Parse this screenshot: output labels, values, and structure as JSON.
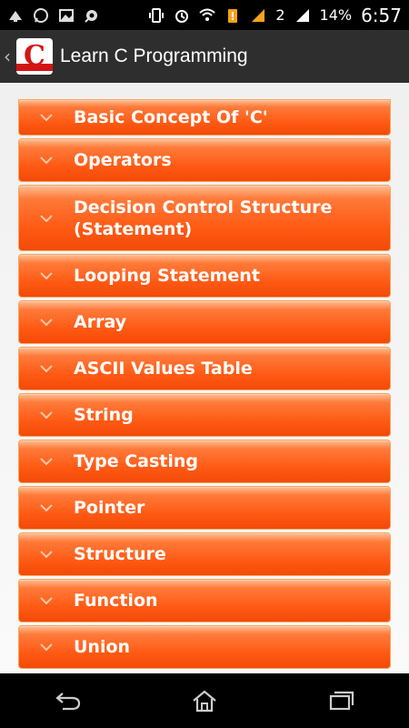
{
  "status_bar": {
    "battery_percent": "14%",
    "time": "6:57",
    "sim_number": "2",
    "left_icons": [
      "cast-icon",
      "whatsapp-icon",
      "gallery-icon",
      "camera-icon"
    ],
    "right_icons": [
      "vibrate-icon",
      "alarm-icon",
      "wifi-icon",
      "battery-warning-icon",
      "signal-icon",
      "signal-icon"
    ]
  },
  "action_bar": {
    "title": "Learn C Programming",
    "logo_letter": "C",
    "logo_caption": "Programming"
  },
  "menu": {
    "items": [
      {
        "label": "Basic Concept Of 'C'"
      },
      {
        "label": "Operators"
      },
      {
        "label": "Decision Control Structure (Statement)"
      },
      {
        "label": "Looping Statement"
      },
      {
        "label": "Array"
      },
      {
        "label": "ASCII Values Table"
      },
      {
        "label": "String"
      },
      {
        "label": "Type Casting"
      },
      {
        "label": "Pointer"
      },
      {
        "label": "Structure"
      },
      {
        "label": "Function"
      },
      {
        "label": "Union"
      }
    ]
  },
  "colors": {
    "accent": "#ff5a14",
    "logo_red": "#d31515",
    "action_bar_bg": "#2e2e2e"
  }
}
